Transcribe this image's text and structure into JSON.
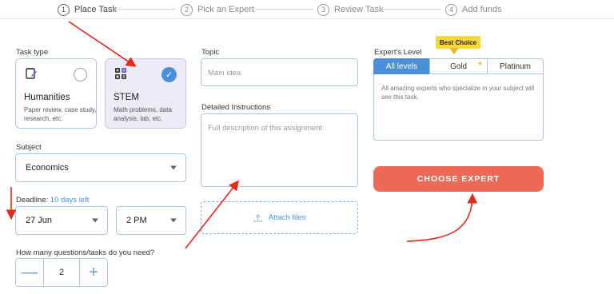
{
  "stepper": {
    "steps": [
      {
        "num": "1",
        "label": "Place Task"
      },
      {
        "num": "2",
        "label": "Pick an Expert"
      },
      {
        "num": "3",
        "label": "Review Task"
      },
      {
        "num": "4",
        "label": "Add funds"
      }
    ]
  },
  "task_type": {
    "label": "Task type",
    "options": [
      {
        "title": "Humanities",
        "desc": "Paper review, case study, research, etc.",
        "selected": false
      },
      {
        "title": "STEM",
        "desc": "Math problems, data analysis, lab, etc.",
        "selected": true
      }
    ]
  },
  "subject": {
    "label": "Subject",
    "value": "Economics"
  },
  "deadline": {
    "label": "Deadline:",
    "hint": "10 days left",
    "date": "27 Jun",
    "time": "2 PM"
  },
  "questions": {
    "label": "How many questions/tasks do you need?",
    "minus": "—",
    "value": "2",
    "plus": "+"
  },
  "topic": {
    "label": "Topic",
    "placeholder": "Main idea"
  },
  "instructions": {
    "label": "Detailed Instructions",
    "placeholder": "Full description of this assignment"
  },
  "attach": {
    "label": "Attach files"
  },
  "level": {
    "label": "Expert's Level",
    "badge": "Best Choice",
    "options": [
      "All levels",
      "Gold",
      "Platinum"
    ],
    "selected": "All levels",
    "description": "All amazing experts who specialize in your subject will see this task."
  },
  "cta": {
    "label": "CHOOSE EXPERT"
  },
  "colors": {
    "accent": "#4a90d9",
    "cta": "#ed6a56",
    "annotation": "#e8271b",
    "badge": "#f6d73a"
  }
}
